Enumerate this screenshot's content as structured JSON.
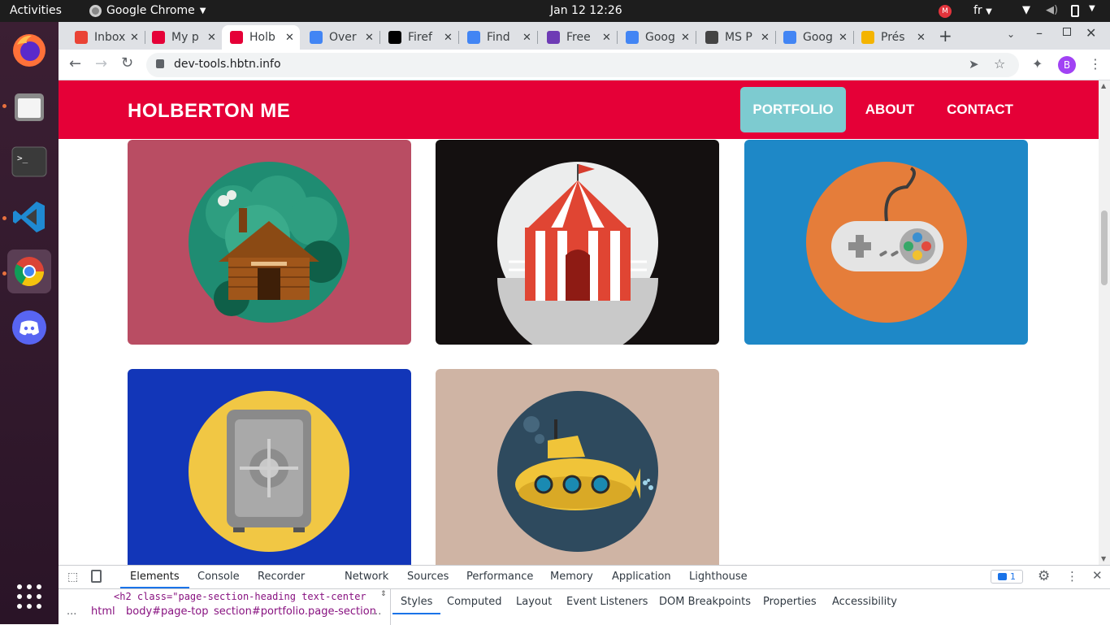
{
  "topbar": {
    "activities": "Activities",
    "app_name": "Google Chrome",
    "datetime": "Jan 12  12:26",
    "keyboard_layout": "fr"
  },
  "tabs": [
    {
      "label": "Inbox",
      "favicon": "gmail-icon",
      "color": "#ea4335"
    },
    {
      "label": "My p",
      "favicon": "holberton-icon",
      "color": "#e50037"
    },
    {
      "label": "Holb",
      "favicon": "holberton-icon",
      "color": "#e50037",
      "active": true
    },
    {
      "label": "Over",
      "favicon": "chrome-icon",
      "color": "#4285f4"
    },
    {
      "label": "Firef",
      "favicon": "codepen-icon",
      "color": "#000000"
    },
    {
      "label": "Find",
      "favicon": "chrome-icon",
      "color": "#4285f4"
    },
    {
      "label": "Free",
      "favicon": "hexagon-icon",
      "color": "#6e3bb5"
    },
    {
      "label": "Goog",
      "favicon": "translate-icon",
      "color": "#4285f4"
    },
    {
      "label": "MS P",
      "favicon": "ms-icon",
      "color": "#444444"
    },
    {
      "label": "Goog",
      "favicon": "google-icon",
      "color": "#4285f4"
    },
    {
      "label": "Prés",
      "favicon": "slides-icon",
      "color": "#f4b400"
    }
  ],
  "address_bar": {
    "url": "dev-tools.hbtn.info"
  },
  "profile_initial": "B",
  "site": {
    "brand": "HOLBERTON ME",
    "nav": [
      {
        "label": "PORTFOLIO",
        "active": true
      },
      {
        "label": "ABOUT",
        "active": false
      },
      {
        "label": "CONTACT",
        "active": false
      }
    ],
    "accent_color": "#e50037",
    "active_nav_color": "#7dcbd0"
  },
  "portfolio": [
    {
      "name": "cabin",
      "bg": "#b94d63"
    },
    {
      "name": "circus-tent",
      "bg": "#141010"
    },
    {
      "name": "game-controller",
      "bg": "#1e88c7"
    },
    {
      "name": "safe",
      "bg": "#1236b8"
    },
    {
      "name": "submarine",
      "bg": "#cfb4a4"
    }
  ],
  "devtools": {
    "tabs": [
      "Elements",
      "Console",
      "Recorder",
      "Network",
      "Sources",
      "Performance",
      "Memory",
      "Application",
      "Lighthouse"
    ],
    "issues_count": "1",
    "code_line": "<h2 class=\"page-section-heading text-center",
    "breadcrumb": [
      "html",
      "body#page-top",
      "section#portfolio.page-section"
    ],
    "breadcrumb_more": "...",
    "breadcrumb_lead": "...",
    "panes": [
      "Styles",
      "Computed",
      "Layout",
      "Event Listeners",
      "DOM Breakpoints",
      "Properties",
      "Accessibility"
    ]
  }
}
